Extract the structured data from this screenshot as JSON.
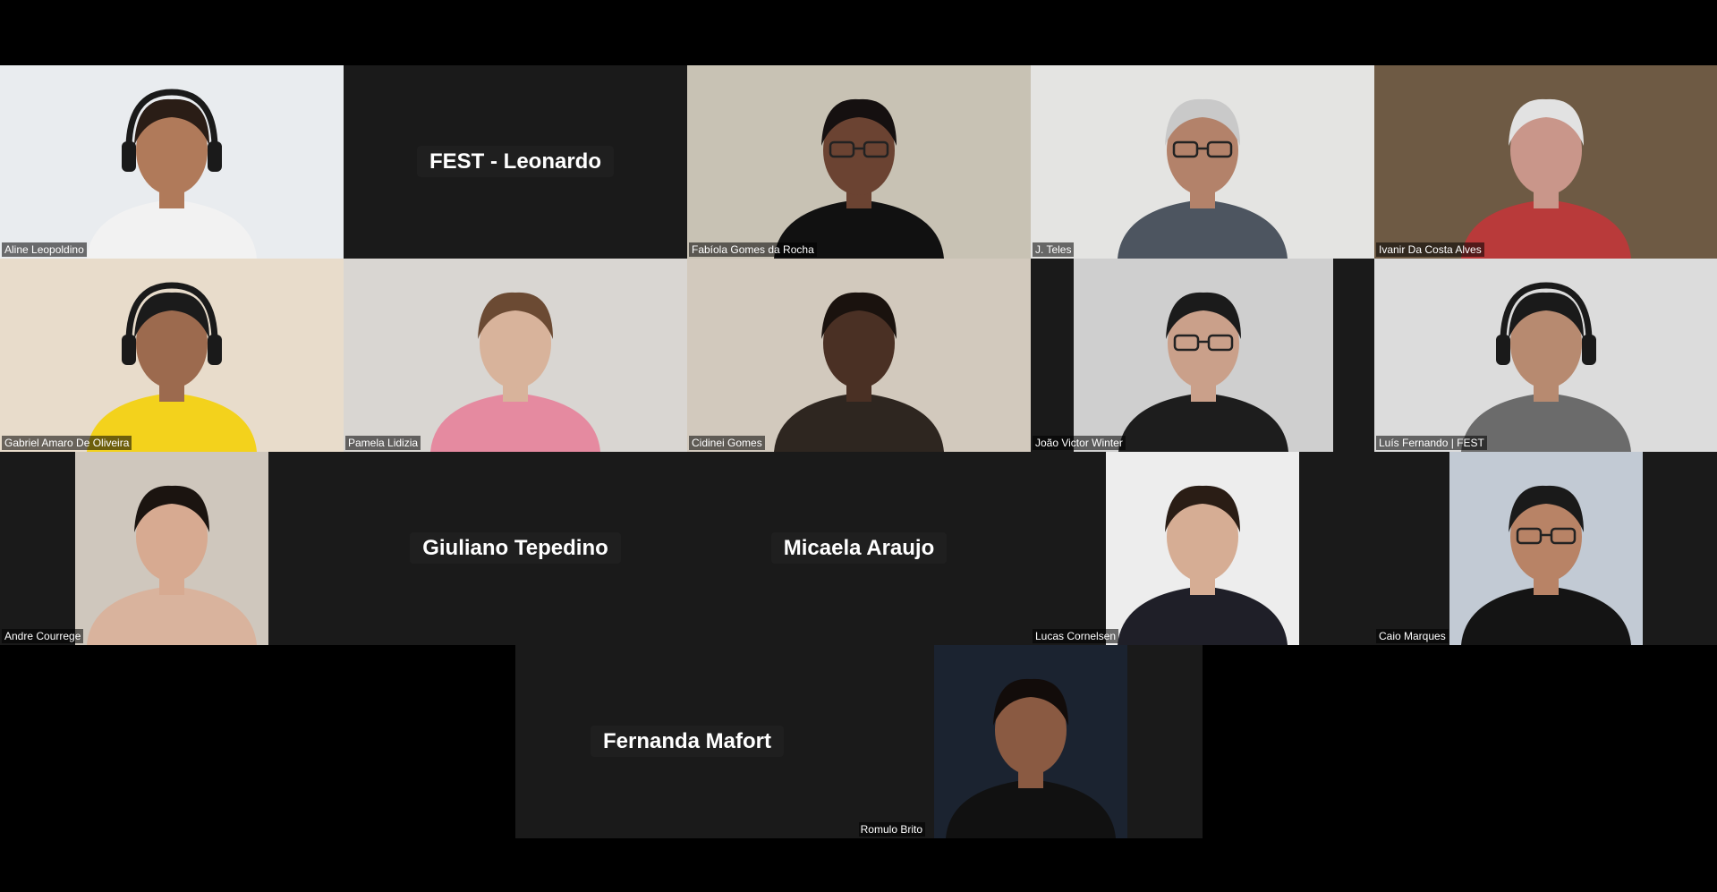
{
  "meeting": {
    "participants": [
      {
        "name": "Aline Leopoldino",
        "mode": "video",
        "bg": "#e9ecef",
        "shirt": "#f2f2f2",
        "skin": "#b07a5a",
        "hair": "#2a1d16",
        "headset": true
      },
      {
        "name": "FEST - Leonardo",
        "mode": "name-only"
      },
      {
        "name": "Fabíola Gomes da Rocha",
        "mode": "video",
        "bg": "#c8c2b4",
        "shirt": "#111111",
        "skin": "#6b4332",
        "hair": "#151010",
        "glasses": true
      },
      {
        "name": "J. Teles",
        "mode": "video",
        "bg": "#e4e4e2",
        "shirt": "#4d5560",
        "skin": "#b3826a",
        "hair": "#c9c9c9",
        "glasses": true
      },
      {
        "name": "Ivanir Da Costa Alves",
        "mode": "video",
        "bg": "#6e5a44",
        "shirt": "#b93a3a",
        "skin": "#c9968a",
        "hair": "#e2e2e2"
      },
      {
        "name": "Gabriel Amaro De Oliveira",
        "mode": "video",
        "bg": "#e8dccb",
        "shirt": "#f3d21c",
        "skin": "#9c6a4e",
        "hair": "#1b1b1b",
        "headset": true
      },
      {
        "name": "Pamela Lidizia",
        "mode": "video",
        "bg": "#d9d6d2",
        "shirt": "#e58aa0",
        "skin": "#d8b39b",
        "hair": "#6b4a33"
      },
      {
        "name": "Cidinei Gomes",
        "mode": "video",
        "bg": "#d2c9bd",
        "shirt": "#2e2620",
        "skin": "#4a3024",
        "hair": "#1a120e"
      },
      {
        "name": "João Victor Winter",
        "mode": "video-narrow",
        "bg": "#cfcfcf",
        "shirt": "#1d1d1d",
        "skin": "#caa08a",
        "hair": "#1b1b1b",
        "glasses": true
      },
      {
        "name": "Luís Fernando | FEST",
        "mode": "video",
        "bg": "#dcdcdc",
        "shirt": "#6b6b6b",
        "skin": "#b78a70",
        "hair": "#1a1a1a",
        "headset": true
      },
      {
        "name": "Andre Courrege",
        "mode": "video-narrow",
        "bg": "#cfc7bd",
        "shirt": "#d9b39d",
        "skin": "#d7aa91",
        "hair": "#1b1410"
      },
      {
        "name": "Giuliano Tepedino",
        "mode": "name-only"
      },
      {
        "name": "Micaela Araujo",
        "mode": "name-only"
      },
      {
        "name": "Lucas Cornelsen",
        "mode": "video-narrow",
        "bg": "#ededed",
        "shirt": "#1f1f28",
        "skin": "#d6ad94",
        "hair": "#2a1d15"
      },
      {
        "name": "Caio Marques",
        "mode": "video-narrow",
        "bg": "#c2cad4",
        "shirt": "#141414",
        "skin": "#b88366",
        "hair": "#1a1a1a",
        "glasses": true
      },
      {
        "name": "Fernanda Mafort",
        "mode": "name-only"
      },
      {
        "name": "Romulo Brito",
        "mode": "video-narrow",
        "bg": "#1b2330",
        "shirt": "#111111",
        "skin": "#8a5a42",
        "hair": "#120c0a",
        "tagRight": true
      }
    ]
  }
}
